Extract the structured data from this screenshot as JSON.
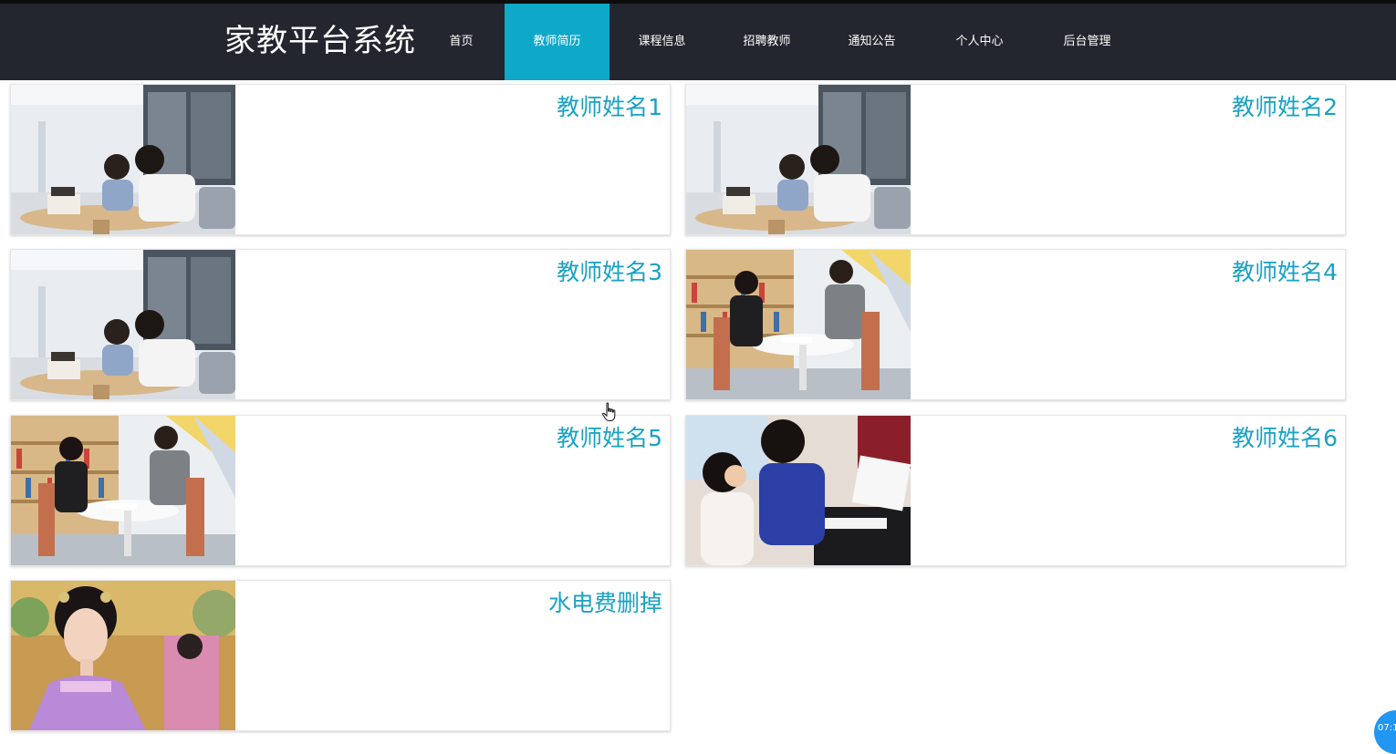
{
  "header": {
    "brand": "家教平台系统",
    "nav": [
      {
        "label": "首页",
        "active": false
      },
      {
        "label": "教师简历",
        "active": true
      },
      {
        "label": "课程信息",
        "active": false
      },
      {
        "label": "招聘教师",
        "active": false
      },
      {
        "label": "通知公告",
        "active": false
      },
      {
        "label": "个人中心",
        "active": false
      },
      {
        "label": "后台管理",
        "active": false
      }
    ]
  },
  "teachers": [
    {
      "name": "教师姓名1",
      "photo": "photo-tutoring-classroom"
    },
    {
      "name": "教师姓名2",
      "photo": "photo-tutoring-classroom"
    },
    {
      "name": "教师姓名3",
      "photo": "photo-tutoring-classroom"
    },
    {
      "name": "教师姓名4",
      "photo": "photo-library-meeting"
    },
    {
      "name": "教师姓名5",
      "photo": "photo-library-meeting"
    },
    {
      "name": "教师姓名6",
      "photo": "photo-piano-lesson"
    },
    {
      "name": "水电费删掉",
      "photo": "photo-costume-portrait"
    }
  ],
  "overlay": {
    "time_badge": "07:1",
    "cursor": "hand-pointer-icon"
  },
  "colors": {
    "navbar": "#23262e",
    "active_tab": "#0ea8c9",
    "teacher_name": "#17a2c5",
    "badge": "#2196f3"
  }
}
